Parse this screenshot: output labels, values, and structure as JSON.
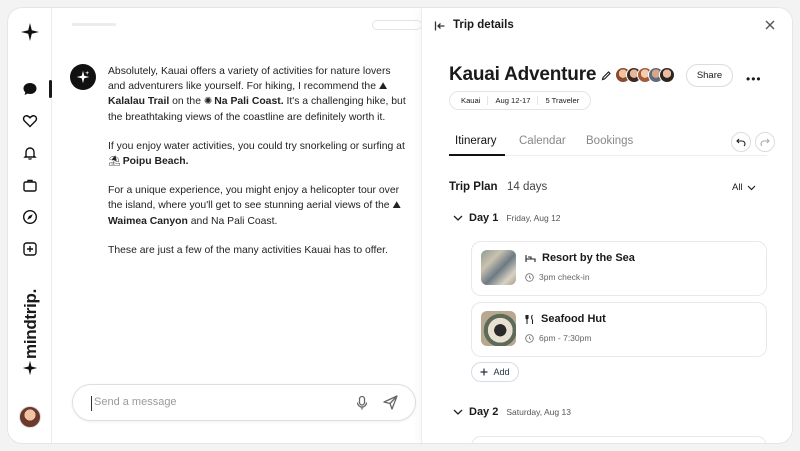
{
  "sidebar": {
    "items": [
      "sparkle-logo-icon",
      "chat-icon",
      "heart-icon",
      "bell-icon",
      "briefcase-icon",
      "compass-icon",
      "plus-square-icon"
    ],
    "brand": "mindtrip."
  },
  "chat": {
    "message": {
      "p1_a": "Absolutely, Kauai offers a variety of activities for nature lovers and adventurers like yourself. For hiking, I recommend the ",
      "p1_trail": "Kalalau Trail",
      "p1_b": " on the ",
      "p1_coast": "Na Pali Coast.",
      "p1_c": " It's a challenging hike, but the breathtaking views of the coastline are definitely worth it.",
      "p2_a": "If you enjoy water activities, you could try snorkeling or surfing at ",
      "p2_beach": "Poipu Beach.",
      "p3_a": "For a unique experience, you might enjoy a helicopter tour over the island, where you'll get to see stunning aerial views of the ",
      "p3_canyon": "Waimea Canyon",
      "p3_b": " and Na Pali Coast.",
      "p4": "These are just a few of the many activities Kauai has to offer."
    },
    "input_placeholder": "Send a message"
  },
  "panel": {
    "header_title": "Trip details",
    "trip_title": "Kauai Adventure",
    "share_label": "Share",
    "tags": [
      "Kauai",
      "Aug 12-17",
      "5 Traveler"
    ],
    "tabs": [
      "Itinerary",
      "Calendar",
      "Bookings"
    ],
    "active_tab": "Itinerary",
    "plan_label": "Trip Plan",
    "plan_days": "14 days",
    "filter_label": "All",
    "day1": {
      "name": "Day 1",
      "date": "Friday, Aug 12"
    },
    "day2": {
      "name": "Day 2",
      "date": "Saturday, Aug 13"
    },
    "cards": [
      {
        "name": "Resort by the Sea",
        "detail": "3pm check-in",
        "icon": "bed-icon"
      },
      {
        "name": "Seafood Hut",
        "detail": "6pm - 7:30pm",
        "icon": "utensils-icon"
      }
    ],
    "add_label": "Add"
  },
  "colors": {
    "accent": "#111111",
    "border": "#e8e8e8",
    "muted": "#888888"
  }
}
